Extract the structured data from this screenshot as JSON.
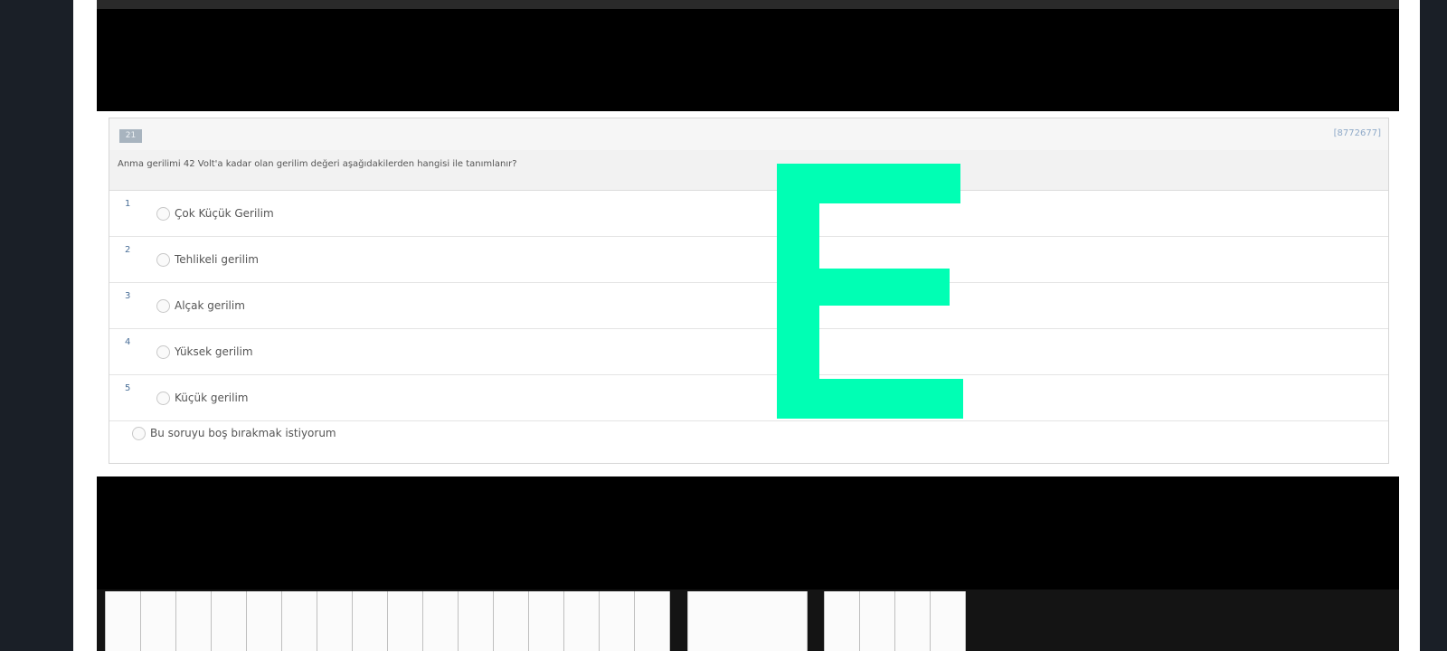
{
  "question": {
    "number": "21",
    "id": "[8772677]",
    "text": "Anma gerilimi 42 Volt'a kadar olan gerilim değeri aşağıdakilerden hangisi ile tanımlanır?",
    "options": [
      {
        "num": "1",
        "label": "Çok Küçük Gerilim"
      },
      {
        "num": "2",
        "label": "Tehlikeli gerilim"
      },
      {
        "num": "3",
        "label": "Alçak gerilim"
      },
      {
        "num": "4",
        "label": "Yüksek gerilim"
      },
      {
        "num": "5",
        "label": "Küçük gerilim"
      }
    ],
    "skip_label": "Bu soruyu boş bırakmak istiyorum"
  },
  "overlay": {
    "letter": "E",
    "color": "#00ffb4"
  }
}
